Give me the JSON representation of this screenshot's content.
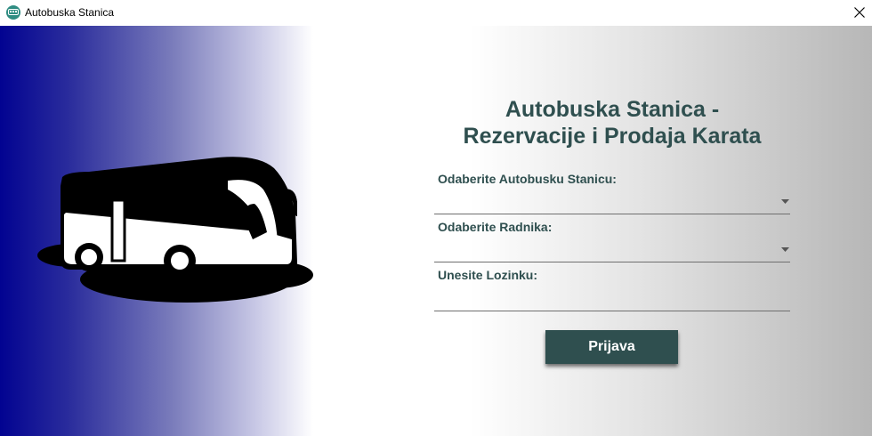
{
  "window": {
    "title": "Autobuska Stanica",
    "icon": "bus-icon",
    "close_icon": "close-icon"
  },
  "colors": {
    "accent": "#2f4f4f",
    "gradient_left": "#020391",
    "app_icon": "#2f8d82"
  },
  "hero": {
    "illustration": "bus-silhouette"
  },
  "form": {
    "title_line1": "Autobuska Stanica -",
    "title_line2": "Rezervacije i Prodaja Karata",
    "station_label": "Odaberite Autobusku Stanicu:",
    "station_value": "",
    "worker_label": "Odaberite Radnika:",
    "worker_value": "",
    "password_label": "Unesite Lozinku:",
    "password_value": "",
    "login_button": "Prijava"
  }
}
